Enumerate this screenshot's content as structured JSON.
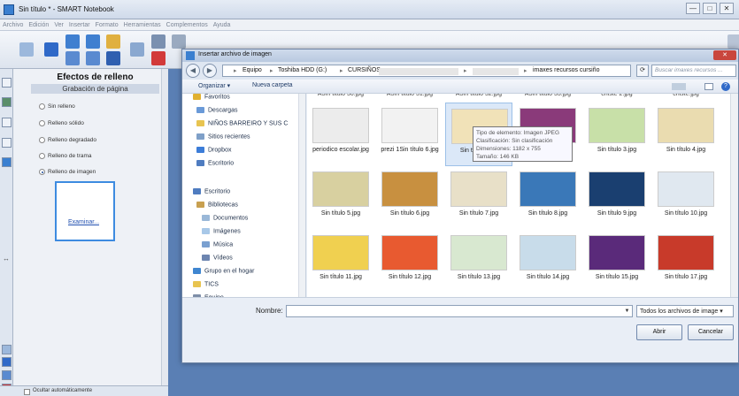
{
  "window": {
    "title": "Sin título * - SMART Notebook",
    "min": "—",
    "max": "□",
    "close": "✕"
  },
  "menu": [
    "Archivo",
    "Edición",
    "Ver",
    "Insertar",
    "Formato",
    "Herramientas",
    "Complementos",
    "Ayuda"
  ],
  "panel": {
    "title": "Efectos de relleno",
    "subtitle": "Grabación de página",
    "options": [
      "Sin relleno",
      "Relleno sólido",
      "Relleno degradado",
      "Relleno de trama",
      "Relleno de imagen"
    ],
    "selected": 4,
    "browse_label": "Examinar...",
    "hide_label": "Ocultar automáticamente"
  },
  "dialog": {
    "title": "Insertar archivo de imagen",
    "path": [
      "Equipo",
      "Toshiba HDD (G:)",
      "CURSIÑOS",
      "imaxes recursos cursiño"
    ],
    "search_placeholder": "Buscar imaxes recursos ...",
    "organize": "Organizar ▾",
    "new_folder": "Nueva carpeta",
    "nav": [
      {
        "label": "Favoritos",
        "color": "#e0b030"
      },
      {
        "label": "Descargas",
        "color": "#6a9ad8"
      },
      {
        "label": "NIÑOS BARREIRO Y SUS C",
        "color": "#e8c450"
      },
      {
        "label": "Sitios recientes",
        "color": "#7fa0c8"
      },
      {
        "label": "Dropbox",
        "color": "#3c7dd8"
      },
      {
        "label": "Escritorio",
        "color": "#4f7cc0"
      },
      {
        "label": "Escritorio",
        "color": "#4f7cc0"
      },
      {
        "label": "Bibliotecas",
        "color": "#c8a050"
      },
      {
        "label": "Documentos",
        "color": "#9ab8d8"
      },
      {
        "label": "Imágenes",
        "color": "#a8c8e8"
      },
      {
        "label": "Música",
        "color": "#7aa0d0"
      },
      {
        "label": "Vídeos",
        "color": "#6d85b0"
      },
      {
        "label": "Grupo en el hogar",
        "color": "#3f86d0"
      },
      {
        "label": "TICS",
        "color": "#e8c450"
      },
      {
        "label": "Equipo",
        "color": "#7e8ea8"
      }
    ],
    "top_partial": [
      "A3In titulo 30.jpg",
      "A3In titulo 31.jpg",
      "A3In titulo 32.jpg",
      "A3In titulo 33.jpg",
      "chiste 2.jpg",
      "chiste.jpg"
    ],
    "files": [
      {
        "name": "periodico escolar.jpg",
        "color": "#ececec"
      },
      {
        "name": "prezi 1Sin título 6.jpg",
        "color": "#f2f2f2"
      },
      {
        "name": "Sin título 1.jpg",
        "color": "#f1e2b8"
      },
      {
        "name": "Sin título 2.jpg",
        "color": "#8a3a7a"
      },
      {
        "name": "Sin título 3.jpg",
        "color": "#c8e0a8"
      },
      {
        "name": "Sin título 4.jpg",
        "color": "#eadcb0"
      },
      {
        "name": "Sin título 5.jpg",
        "color": "#d8d0a0"
      },
      {
        "name": "Sin título 6.jpg",
        "color": "#c89040"
      },
      {
        "name": "Sin título 7.jpg",
        "color": "#e8e0c8"
      },
      {
        "name": "Sin título 8.jpg",
        "color": "#3a78b8"
      },
      {
        "name": "Sin título 9.jpg",
        "color": "#1a3f70"
      },
      {
        "name": "Sin título 10.jpg",
        "color": "#e0e8f0"
      },
      {
        "name": "Sin título 11.jpg",
        "color": "#f0d050"
      },
      {
        "name": "Sin título 12.jpg",
        "color": "#e85a30"
      },
      {
        "name": "Sin título 13.jpg",
        "color": "#d8e8d0"
      },
      {
        "name": "Sin título 14.jpg",
        "color": "#c8dcea"
      },
      {
        "name": "Sin título 15.jpg",
        "color": "#5a2a7a"
      },
      {
        "name": "Sin título 17.jpg",
        "color": "#c83a2a"
      }
    ],
    "tooltip": [
      "Tipo de elemento: Imagen JPEG",
      "Clasificación: Sin clasificación",
      "Dimensiones: 1182 x 755",
      "Tamaño: 146 KB"
    ],
    "name_label": "Nombre:",
    "file_type": "Todos los archivos de image ▾",
    "open_label": "Abrir",
    "cancel_label": "Cancelar"
  }
}
